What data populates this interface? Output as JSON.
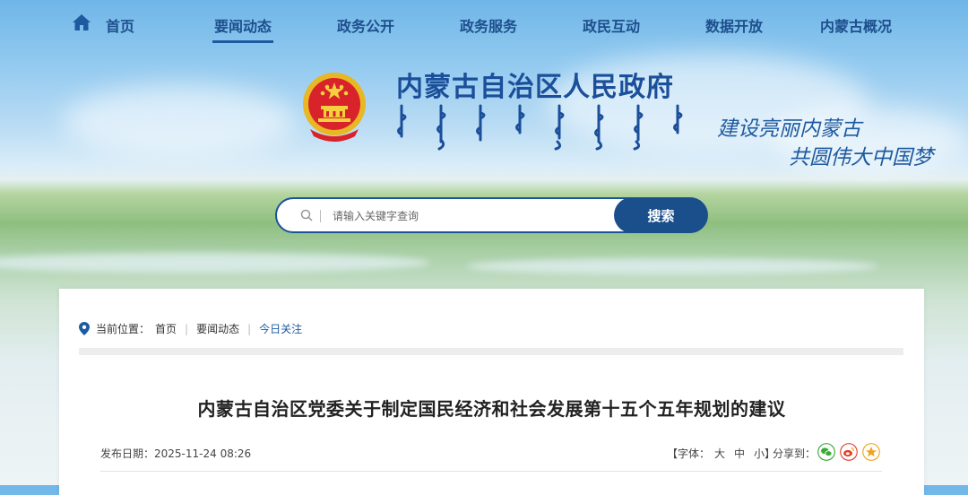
{
  "nav": {
    "items": [
      {
        "label": "首页"
      },
      {
        "label": "要闻动态"
      },
      {
        "label": "政务公开"
      },
      {
        "label": "政务服务"
      },
      {
        "label": "政民互动"
      },
      {
        "label": "数据开放"
      },
      {
        "label": "内蒙古概况"
      }
    ],
    "active": "要闻动态"
  },
  "header": {
    "site_title": "内蒙古自治区人民政府",
    "slogan_line1": "建设亮丽内蒙古",
    "slogan_line2": "共圆伟大中国梦"
  },
  "search": {
    "placeholder": "请输入关键字查询",
    "button_label": "搜索"
  },
  "breadcrumb": {
    "prefix": "当前位置：",
    "items": [
      "首页",
      "要闻动态",
      "今日关注"
    ]
  },
  "article": {
    "title": "内蒙古自治区党委关于制定国民经济和社会发展第十五个五年规划的建议",
    "date_label": "发布日期：",
    "date_value": "2025-11-24 08:26",
    "font_label": "【字体：",
    "font_large": "大",
    "font_medium": "中",
    "font_small": "小】",
    "share_label": "分享到："
  },
  "colors": {
    "brand": "#1d4f8c",
    "accent": "#1a5397",
    "wechat": "#3aaa35",
    "weibo": "#e0402e",
    "qzone": "#f0a31b"
  },
  "icons": [
    "home-icon",
    "emblem",
    "search-icon",
    "location-pin-icon",
    "wechat-icon",
    "weibo-icon",
    "qzone-icon"
  ]
}
